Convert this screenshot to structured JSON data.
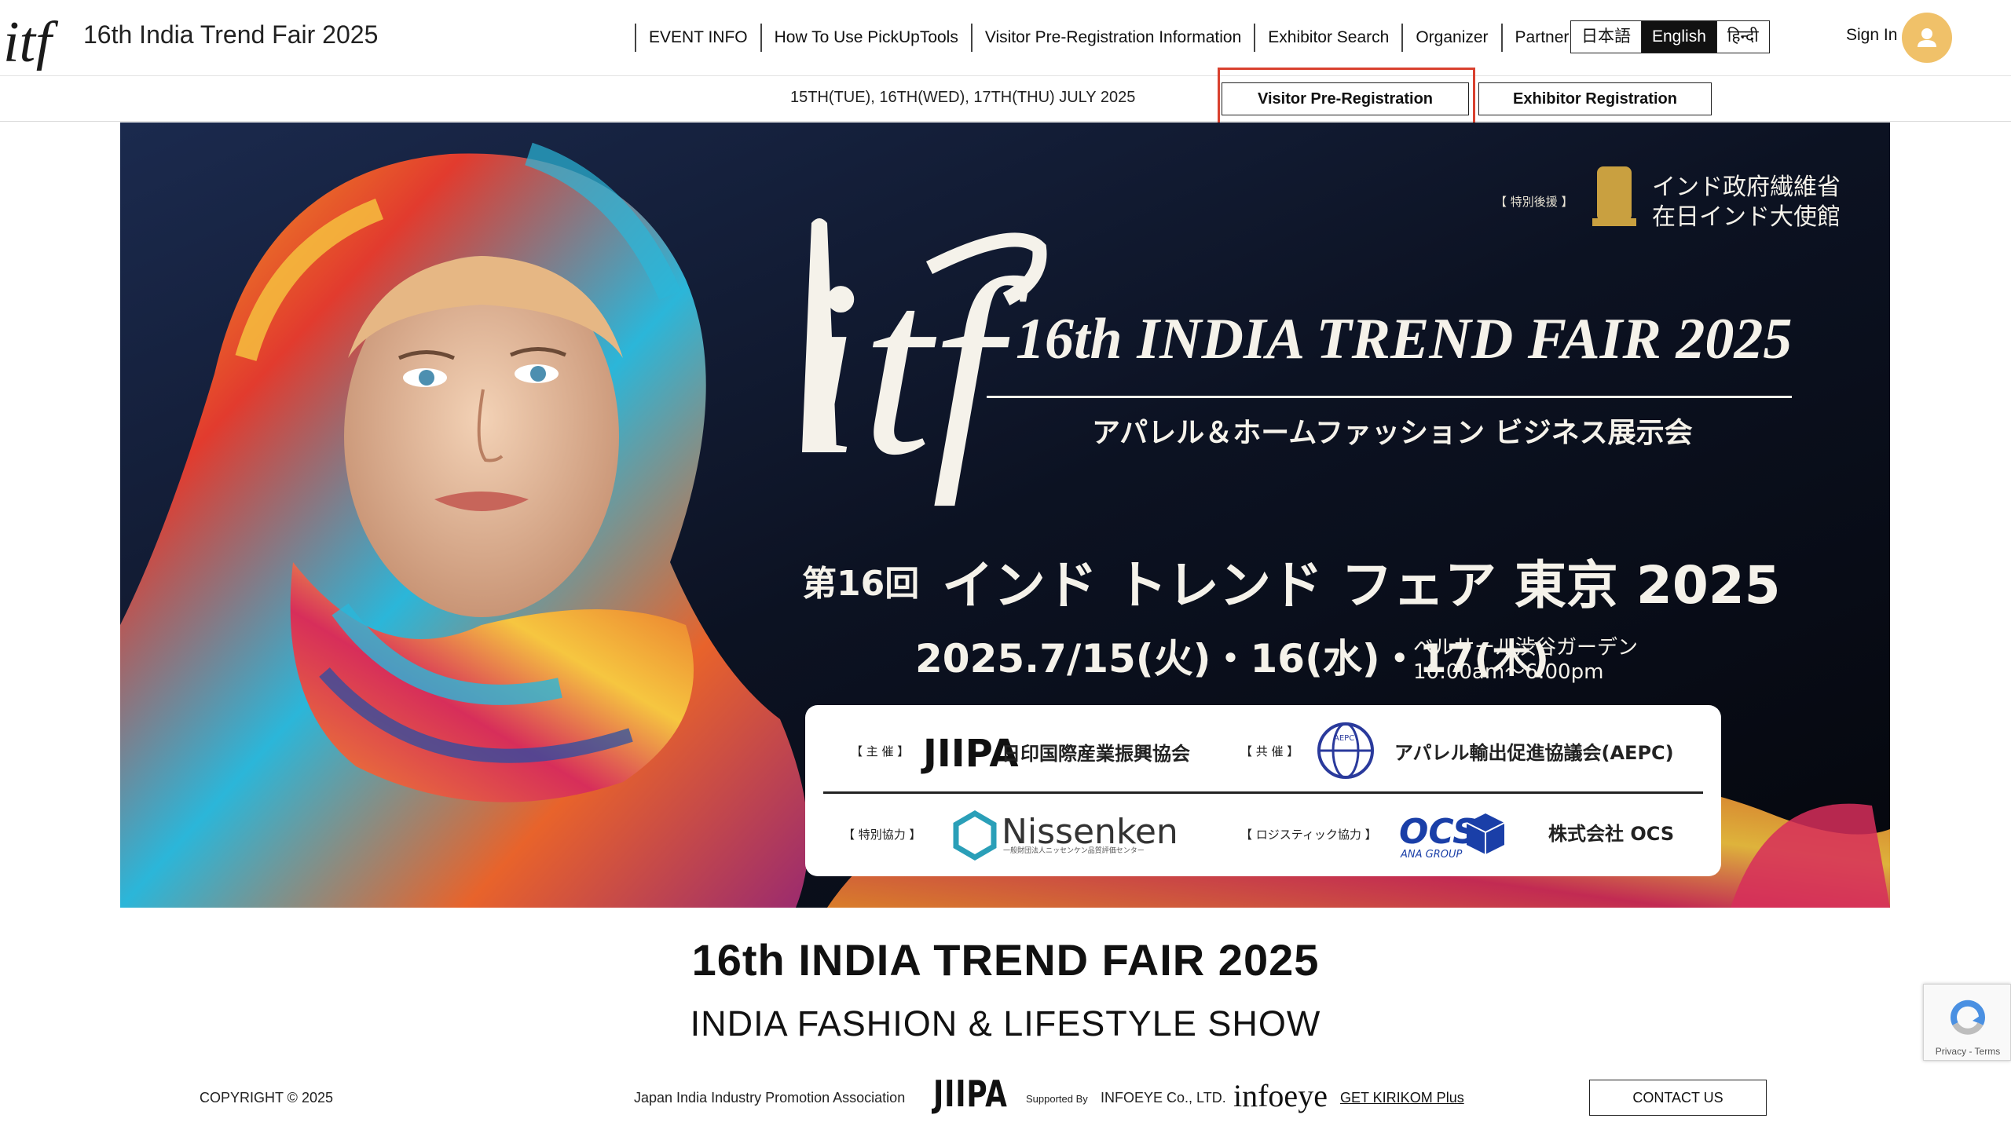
{
  "header": {
    "site_title": "16th India Trend Fair 2025",
    "nav": [
      "EVENT INFO",
      "How To Use PickUpTools",
      "Visitor Pre-Registration Information",
      "Exhibitor Search",
      "Organizer",
      "Partner"
    ],
    "languages": [
      "日本語",
      "English",
      "हिन्दी"
    ],
    "active_language": "English",
    "sign_in": "Sign In"
  },
  "subbar": {
    "dates": "15TH(TUE), 16TH(WED), 17TH(THU) JULY 2025",
    "visitor_registration": "Visitor Pre-Registration",
    "exhibitor_registration": "Exhibitor Registration"
  },
  "hero": {
    "logo_text": "itf",
    "support_bracket": "【 特別後援 】",
    "support_line1": "インド政府繊維省",
    "support_line2": "在日インド大使館",
    "title_en": "16th INDIA TREND FAIR 2025",
    "subtitle_ja": "アパレル＆ホームファッション ビジネス展示会",
    "edition_ja": "第16回",
    "title_ja": "インド トレンド フェア 東京 2025",
    "dates_ja": "2025.7/15(火)・16(水)・17(木)",
    "venue_line1": "ベルサール渋谷ガーデン",
    "venue_line2": "10:00am～6:00pm",
    "sponsors": {
      "organizer_label": "【 主 催 】",
      "organizer_logo": "JIIPA",
      "organizer_name": "日印国際産業振興協会",
      "cohost_label": "【 共 催 】",
      "cohost_logo": "AEPC",
      "cohost_name": "アパレル輸出促進協議会(AEPC)",
      "special_label": "【 特別協力 】",
      "special_logo": "Nissenken",
      "special_sub": "一般財団法人ニッセンケン品質評価センター",
      "logistics_label": "【 ロジスティック協力 】",
      "logistics_logo": "OCS",
      "logistics_sub": "ANA GROUP",
      "logistics_name": "株式会社 OCS"
    }
  },
  "headings": {
    "title": "16th INDIA TREND FAIR 2025",
    "subtitle": "INDIA FASHION & LIFESTYLE SHOW"
  },
  "footer": {
    "copyright": "COPYRIGHT © 2025",
    "organization": "Japan India Industry Promotion Association",
    "jiipa_logo": "JIIPA",
    "supported_by": "Supported By",
    "infoeye": "INFOEYE Co., LTD.",
    "infoeye_logo": "infoeye",
    "kirikom": "GET KIRIKOM Plus",
    "contact": "CONTACT US"
  },
  "recaptcha": {
    "text": "Privacy - Terms"
  },
  "colors": {
    "highlight": "#d9412f",
    "avatar": "#f0c169",
    "active_lang_bg": "#111111",
    "hero_bg": "#0e1424",
    "aepc_blue": "#2a3a9c",
    "ocs_blue": "#1a3fa8",
    "nissenken_teal": "#2a9fb8"
  }
}
